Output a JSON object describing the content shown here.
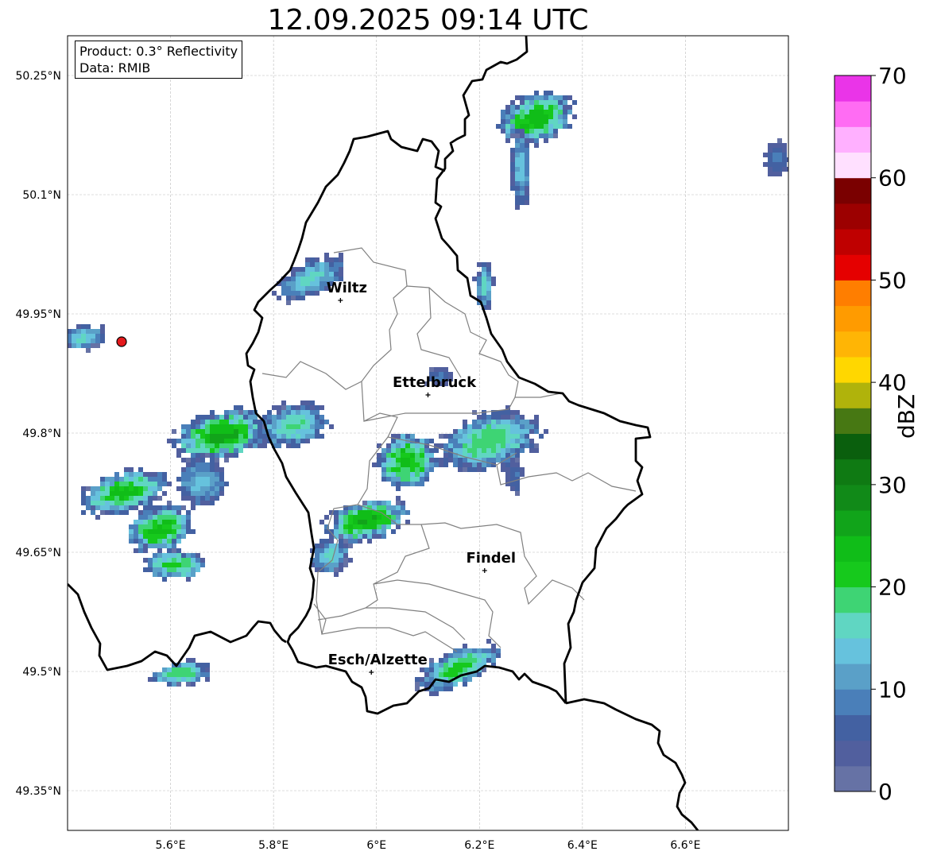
{
  "title": "12.09.2025 09:14 UTC",
  "info": {
    "product": "Product: 0.3° Reflectivity",
    "data": "Data: RMIB"
  },
  "axes": {
    "lon_range": [
      5.4,
      6.8
    ],
    "lat_range": [
      49.3,
      50.3
    ],
    "lat_ticks": [
      {
        "value": 50.25,
        "label": "50.25°N"
      },
      {
        "value": 50.1,
        "label": "50.1°N"
      },
      {
        "value": 49.95,
        "label": "49.95°N"
      },
      {
        "value": 49.8,
        "label": "49.8°N"
      },
      {
        "value": 49.65,
        "label": "49.65°N"
      },
      {
        "value": 49.5,
        "label": "49.5°N"
      },
      {
        "value": 49.35,
        "label": "49.35°N"
      }
    ],
    "lon_ticks": [
      {
        "value": 5.6,
        "label": "5.6°E"
      },
      {
        "value": 5.8,
        "label": "5.8°E"
      },
      {
        "value": 6.0,
        "label": "6°E"
      },
      {
        "value": 6.2,
        "label": "6.2°E"
      },
      {
        "value": 6.4,
        "label": "6.4°E"
      },
      {
        "value": 6.6,
        "label": "6.6°E"
      }
    ],
    "grid": true
  },
  "cities": [
    {
      "name": "Wiltz",
      "lon": 5.93,
      "lat": 49.967
    },
    {
      "name": "Ettelbruck",
      "lon": 6.1,
      "lat": 49.848
    },
    {
      "name": "Findel",
      "lon": 6.21,
      "lat": 49.627
    },
    {
      "name": "Esch/Alzette",
      "lon": 5.99,
      "lat": 49.499
    }
  ],
  "radar_site": {
    "lon": 5.505,
    "lat": 49.915,
    "color": "#e41a1c"
  },
  "colorbar": {
    "label": "dBZ",
    "min": 0,
    "max": 70,
    "step": 2.5,
    "ticks": [
      {
        "value": 0,
        "label": "0"
      },
      {
        "value": 10,
        "label": "10"
      },
      {
        "value": 20,
        "label": "20"
      },
      {
        "value": 30,
        "label": "30"
      },
      {
        "value": 40,
        "label": "40"
      },
      {
        "value": 50,
        "label": "50"
      },
      {
        "value": 60,
        "label": "60"
      },
      {
        "value": 70,
        "label": "70"
      }
    ],
    "colors": [
      "#6672a5",
      "#515f9e",
      "#4361a2",
      "#4a7fb9",
      "#5aa0c8",
      "#66c2dd",
      "#60d6c2",
      "#3ed474",
      "#16c91c",
      "#10bd18",
      "#11a41a",
      "#118a18",
      "#0f7a13",
      "#0a5f0d",
      "#477813",
      "#b0b30b",
      "#ffd700",
      "#ffb505",
      "#ff9b00",
      "#ff7e00",
      "#e50000",
      "#bf0000",
      "#9c0000",
      "#7a0000",
      "#ffe0ff",
      "#ffb0ff",
      "#ff6cf3",
      "#ea34e8"
    ]
  },
  "echoes": [
    {
      "lon": 6.31,
      "lat": 50.195,
      "rx": 0.075,
      "ry": 0.032,
      "rot": -20,
      "core": 22
    },
    {
      "lon": 6.28,
      "lat": 50.135,
      "rx": 0.02,
      "ry": 0.05,
      "rot": 0,
      "core": 12
    },
    {
      "lon": 6.21,
      "lat": 49.985,
      "rx": 0.018,
      "ry": 0.03,
      "rot": 0,
      "core": 14
    },
    {
      "lon": 5.875,
      "lat": 49.995,
      "rx": 0.07,
      "ry": 0.022,
      "rot": -25,
      "core": 14
    },
    {
      "lon": 6.78,
      "lat": 50.145,
      "rx": 0.025,
      "ry": 0.025,
      "rot": 0,
      "core": 6
    },
    {
      "lon": 5.7,
      "lat": 49.797,
      "rx": 0.095,
      "ry": 0.03,
      "rot": -12,
      "core": 24
    },
    {
      "lon": 5.84,
      "lat": 49.81,
      "rx": 0.07,
      "ry": 0.028,
      "rot": -15,
      "core": 16
    },
    {
      "lon": 5.51,
      "lat": 49.725,
      "rx": 0.085,
      "ry": 0.026,
      "rot": -15,
      "core": 22
    },
    {
      "lon": 5.66,
      "lat": 49.738,
      "rx": 0.05,
      "ry": 0.03,
      "rot": -10,
      "core": 12
    },
    {
      "lon": 5.58,
      "lat": 49.679,
      "rx": 0.065,
      "ry": 0.028,
      "rot": -15,
      "core": 22
    },
    {
      "lon": 5.61,
      "lat": 49.634,
      "rx": 0.06,
      "ry": 0.018,
      "rot": 0,
      "core": 20
    },
    {
      "lon": 6.06,
      "lat": 49.765,
      "rx": 0.06,
      "ry": 0.035,
      "rot": -25,
      "core": 22
    },
    {
      "lon": 6.22,
      "lat": 49.79,
      "rx": 0.1,
      "ry": 0.035,
      "rot": -15,
      "core": 18
    },
    {
      "lon": 5.98,
      "lat": 49.69,
      "rx": 0.08,
      "ry": 0.025,
      "rot": -15,
      "core": 24
    },
    {
      "lon": 5.91,
      "lat": 49.645,
      "rx": 0.04,
      "ry": 0.022,
      "rot": -30,
      "core": 14
    },
    {
      "lon": 6.16,
      "lat": 49.505,
      "rx": 0.085,
      "ry": 0.022,
      "rot": -25,
      "core": 20
    },
    {
      "lon": 5.62,
      "lat": 49.497,
      "rx": 0.06,
      "ry": 0.015,
      "rot": -8,
      "core": 18
    },
    {
      "lon": 5.43,
      "lat": 49.92,
      "rx": 0.05,
      "ry": 0.015,
      "rot": -5,
      "core": 14
    },
    {
      "lon": 6.27,
      "lat": 49.745,
      "rx": 0.015,
      "ry": 0.025,
      "rot": 0,
      "core": 6
    },
    {
      "lon": 6.12,
      "lat": 49.87,
      "rx": 0.025,
      "ry": 0.012,
      "rot": 0,
      "core": 6
    }
  ]
}
